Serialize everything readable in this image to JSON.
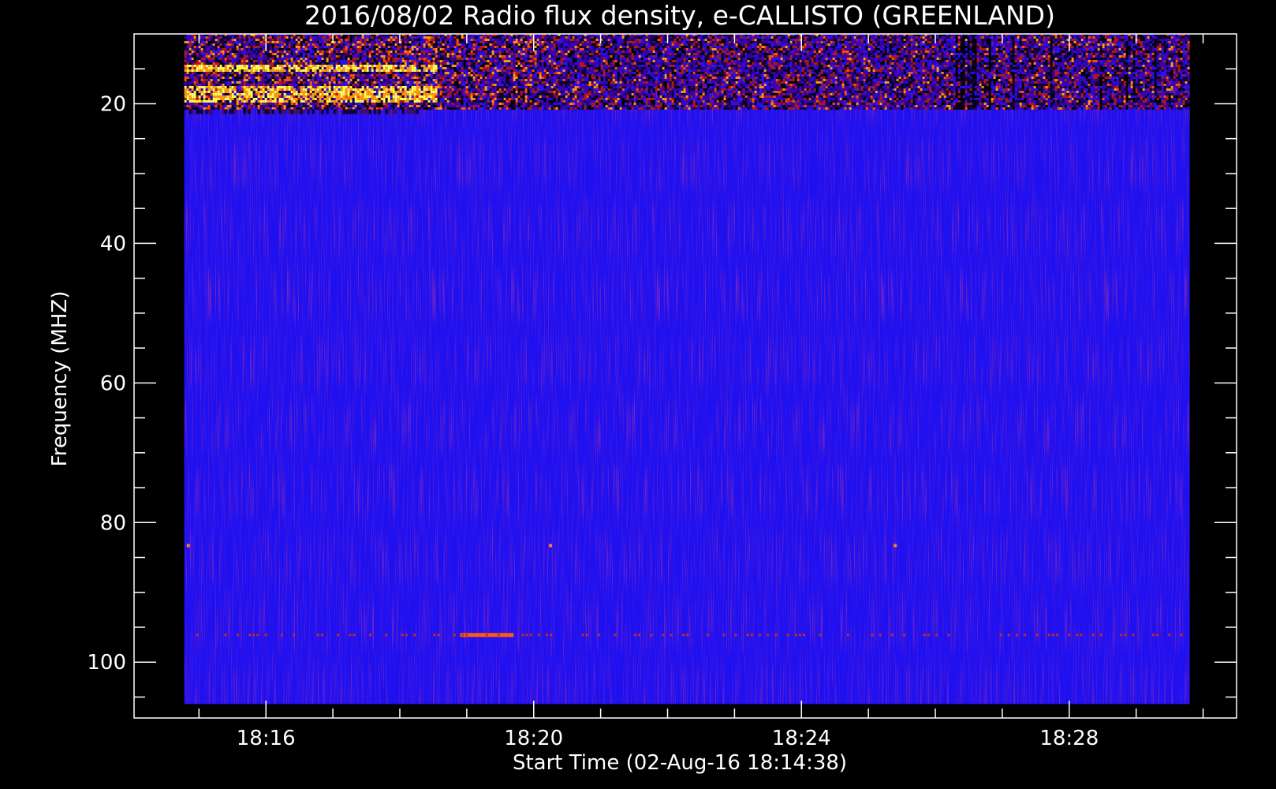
{
  "chart_data": {
    "type": "heatmap",
    "title": "2016/08/02  Radio flux density, e-CALLISTO (GREENLAND)",
    "xlabel": "Start Time (02-Aug-16 18:14:38)",
    "ylabel": "Frequency (MHZ)",
    "x_ticks": [
      "18:16",
      "18:20",
      "18:24",
      "18:28"
    ],
    "x_tick_minutes": [
      16,
      20,
      24,
      28
    ],
    "y_ticks": [
      "20",
      "40",
      "60",
      "80",
      "100"
    ],
    "y_tick_values": [
      20,
      40,
      60,
      80,
      100
    ],
    "xlim_minutes": [
      14.03,
      30.5
    ],
    "ylim": [
      10,
      108
    ],
    "data_extent_minutes": [
      14.78,
      29.8
    ],
    "data_extent_mhz": [
      10,
      106
    ],
    "y_inverted": true,
    "colorscale": [
      "#000000",
      "#2a00d8",
      "#c01010",
      "#ff8000",
      "#ffff40"
    ],
    "colors": {
      "background": "#000000",
      "axes": "#ffffff",
      "field": "#1f10f0"
    }
  }
}
